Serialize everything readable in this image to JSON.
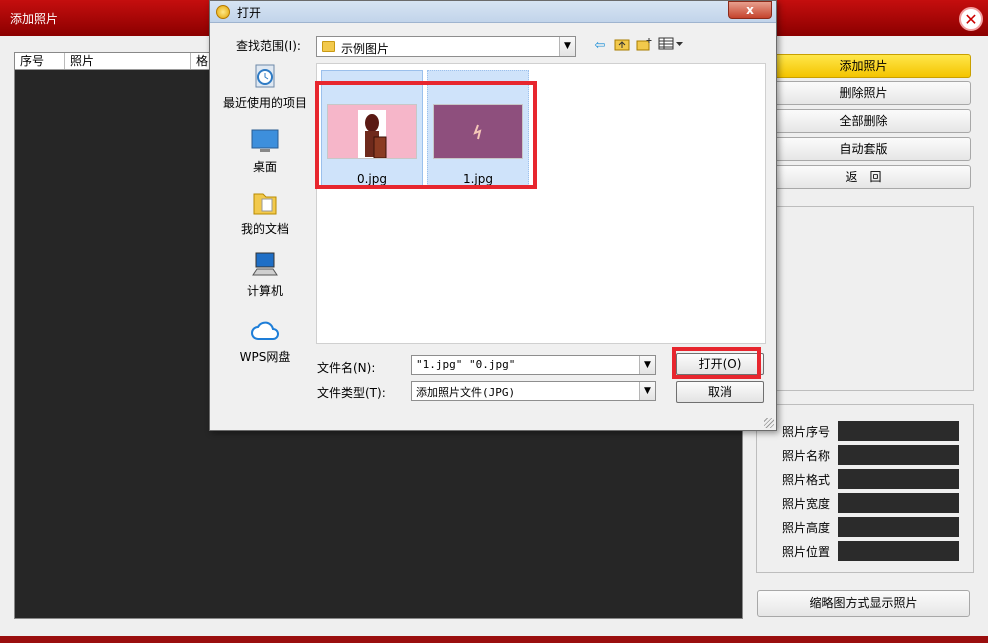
{
  "window": {
    "title": "添加照片",
    "close_icon": "close-icon"
  },
  "list": {
    "columns": [
      "序号",
      "照片",
      "格"
    ]
  },
  "actions": {
    "add": "添加照片",
    "delete": "删除照片",
    "delete_all": "全部删除",
    "auto_layout": "自动套版",
    "back": "返　回"
  },
  "info": {
    "labels": [
      "照片序号",
      "照片名称",
      "照片格式",
      "照片宽度",
      "照片高度",
      "照片位置"
    ]
  },
  "thumbnail_button": "缩略图方式显示照片",
  "dialog": {
    "title": "打开",
    "close": "x",
    "lookin_label": "查找范围(I):",
    "lookin_value": "示例图片",
    "places": [
      "最近使用的项目",
      "桌面",
      "我的文档",
      "计算机",
      "WPS网盘"
    ],
    "files": [
      {
        "name": "0.jpg"
      },
      {
        "name": "1.jpg"
      }
    ],
    "filename_label": "文件名(N):",
    "filename_value": "\"1.jpg\" \"0.jpg\"",
    "filetype_label": "文件类型(T):",
    "filetype_value": "添加照片文件(JPG)",
    "open_button": "打开(O)",
    "cancel_button": "取消"
  },
  "colors": {
    "titlebar": "#b30c0c",
    "highlight": "#e7262e",
    "active_button": "#f7cd10",
    "panel_dark": "#262626"
  }
}
